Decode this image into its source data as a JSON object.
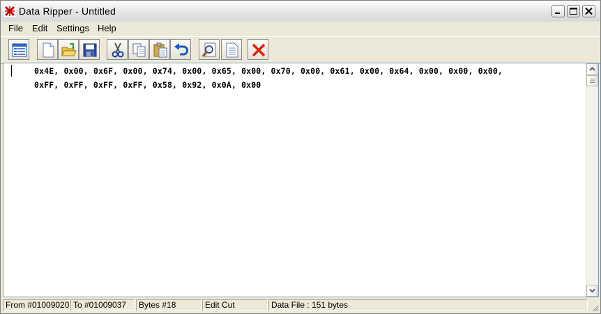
{
  "window": {
    "title": "Data Ripper - Untitled"
  },
  "menu": [
    {
      "label": "File"
    },
    {
      "label": "Edit"
    },
    {
      "label": "Settings"
    },
    {
      "label": "Help"
    }
  ],
  "toolbar": {
    "icons": [
      "list-view-icon",
      "new-file-icon",
      "open-folder-icon",
      "save-icon",
      "cut-icon",
      "copy-icon",
      "paste-icon",
      "undo-icon",
      "find-icon",
      "page-icon",
      "delete-icon"
    ]
  },
  "editor": {
    "lines": [
      "0x4E, 0x00, 0x6F, 0x00, 0x74, 0x00, 0x65, 0x00, 0x70, 0x00, 0x61, 0x00, 0x64, 0x00, 0x00, 0x00,",
      "0xFF, 0xFF, 0xFF, 0xFF, 0x58, 0x92, 0x0A, 0x00"
    ]
  },
  "status": {
    "from": "From #01009020",
    "to": "To #01009037",
    "bytes": "Bytes #18",
    "mode": "Edit Cut",
    "file": "Data File : 151 bytes"
  }
}
